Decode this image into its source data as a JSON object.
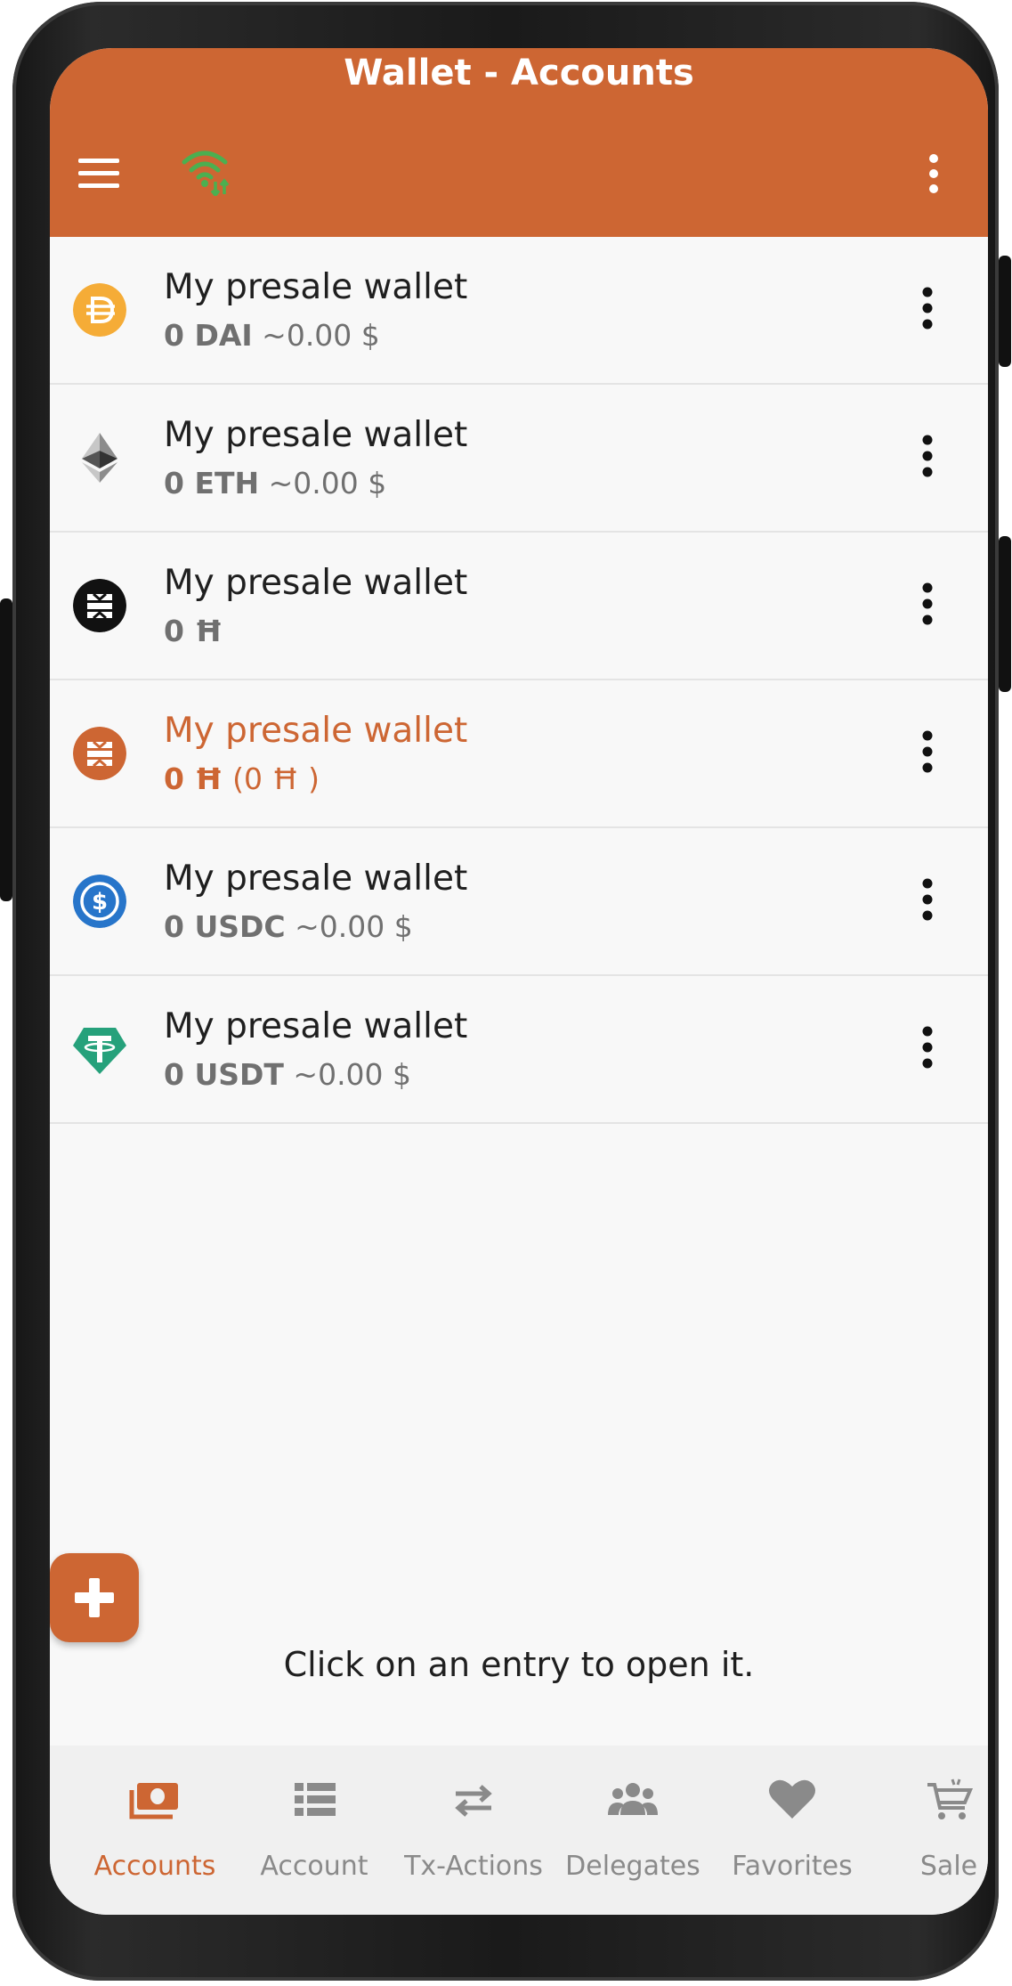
{
  "header": {
    "title": "Wallet - Accounts"
  },
  "accounts": [
    {
      "name": "My presale wallet",
      "amount": "0 DAI",
      "fiat": "~0.00 $",
      "icon": "dai-icon"
    },
    {
      "name": "My presale wallet",
      "amount": "0 ETH",
      "fiat": "~0.00 $",
      "icon": "eth-icon"
    },
    {
      "name": "My presale wallet",
      "amount": "0 Ħ",
      "fiat": "",
      "icon": "hbar-icon"
    },
    {
      "name": "My presale wallet",
      "amount": "0 Ħ",
      "fiat": "(0 Ħ )",
      "icon": "hbar-orange-icon"
    },
    {
      "name": "My presale wallet",
      "amount": "0 USDC",
      "fiat": "~0.00 $",
      "icon": "usdc-icon"
    },
    {
      "name": "My presale wallet",
      "amount": "0 USDT",
      "fiat": "~0.00 $",
      "icon": "usdt-icon"
    }
  ],
  "hint": "Click on an entry to open it.",
  "nav": [
    {
      "label": "Accounts",
      "icon": "money-icon"
    },
    {
      "label": "Account",
      "icon": "list-icon"
    },
    {
      "label": "Tx-Actions",
      "icon": "swap-icon"
    },
    {
      "label": "Delegates",
      "icon": "group-icon"
    },
    {
      "label": "Favorites",
      "icon": "heart-icon"
    },
    {
      "label": "Sale",
      "icon": "cart-icon"
    }
  ],
  "colors": {
    "accent": "#cd6633",
    "connected": "#4caf50"
  }
}
